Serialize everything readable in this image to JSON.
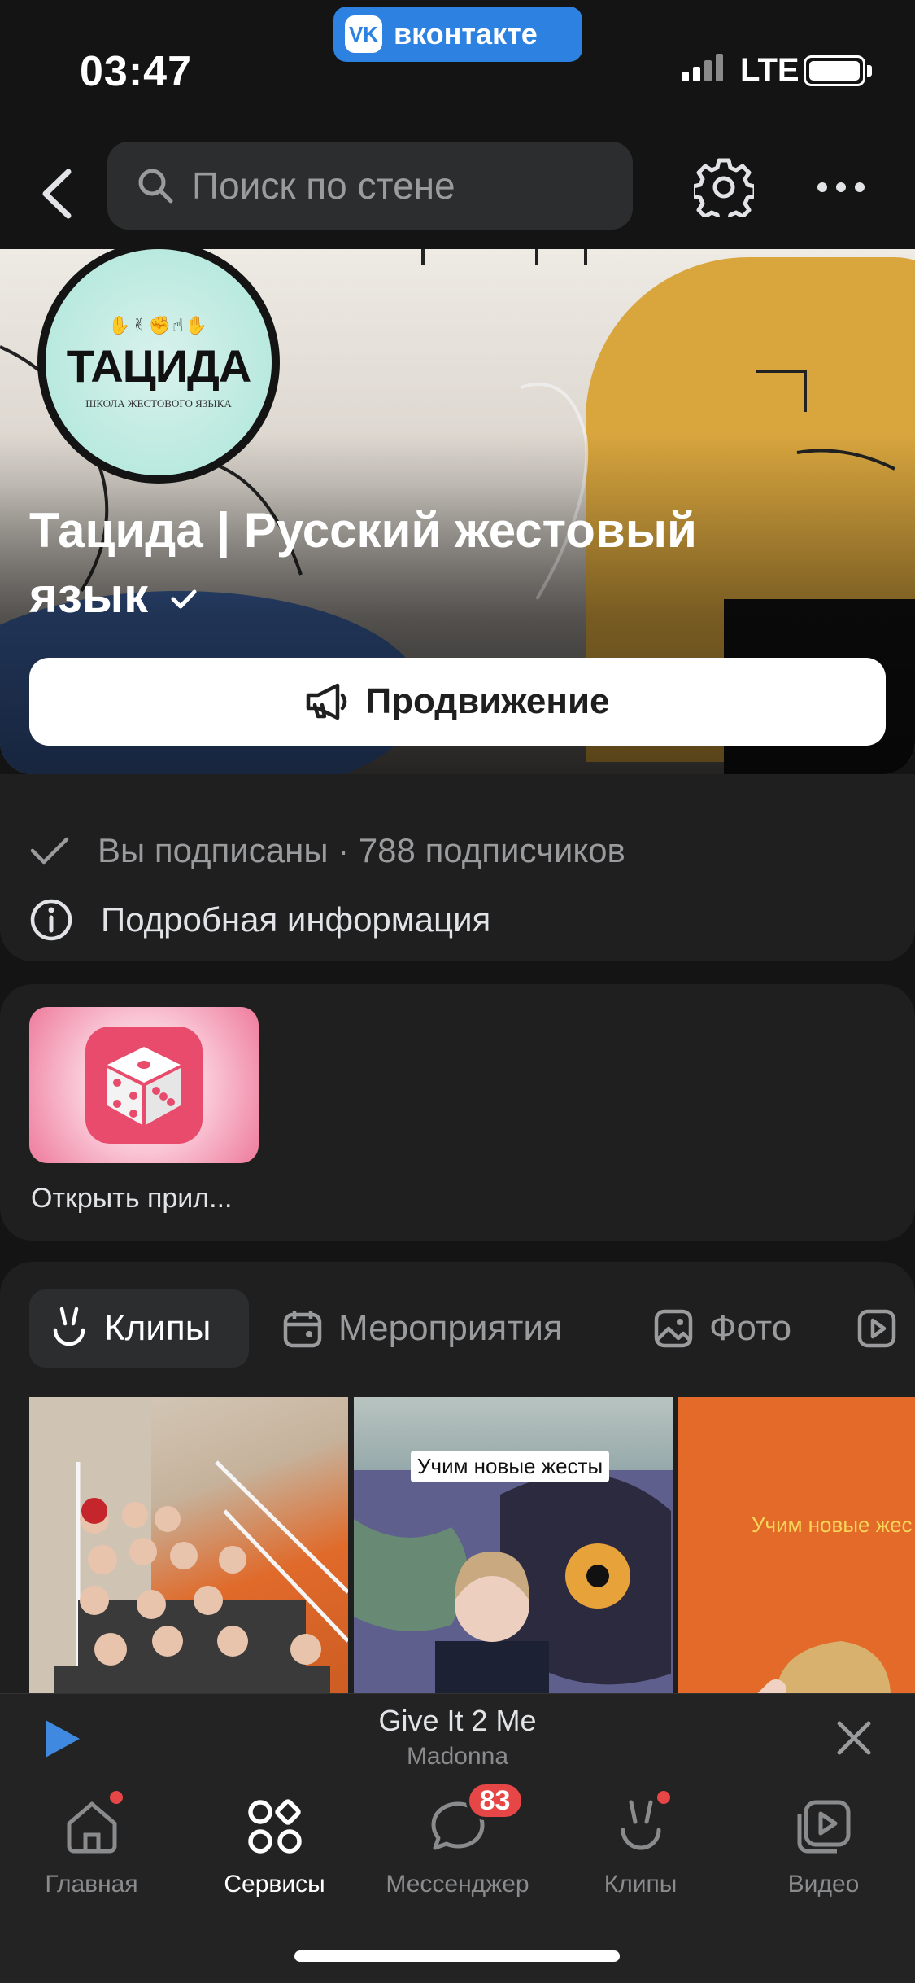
{
  "status_bar": {
    "time": "03:47",
    "app_badge": "вконтакте",
    "network": "LTE"
  },
  "header": {
    "search_placeholder": "Поиск по стене",
    "icons": [
      "back-arrow",
      "search",
      "gear",
      "more-dots"
    ]
  },
  "group": {
    "avatar_title": "ТАЦИДА",
    "avatar_subtitle": "ШКОЛА ЖЕСТОВОГО ЯЗЫКА",
    "name": "Тацида | Русский жестовый язык",
    "verified": true,
    "promo_button": "Продвижение"
  },
  "info": {
    "subscription": "Вы подписаны · 788 подписчиков",
    "details": "Подробная информация"
  },
  "apps": {
    "items": [
      {
        "label": "Открыть прил...",
        "icon": "dice-icon",
        "color": "#e84b6b"
      }
    ]
  },
  "media": {
    "tabs": [
      {
        "label": "Клипы",
        "icon": "clips-icon",
        "active": true
      },
      {
        "label": "Мероприятия",
        "icon": "calendar-icon",
        "active": false
      },
      {
        "label": "Фото",
        "icon": "photo-icon",
        "active": false
      }
    ],
    "clips": [
      {
        "caption": ""
      },
      {
        "caption": "Учим новые жесты"
      },
      {
        "caption": "Учим новые жес"
      }
    ]
  },
  "player": {
    "title": "Give It 2 Me",
    "artist": "Madonna",
    "accent": "#3f8ae0"
  },
  "tabbar": {
    "items": [
      {
        "label": "Главная",
        "icon": "home-icon",
        "active": false,
        "dot": true
      },
      {
        "label": "Сервисы",
        "icon": "services-icon",
        "active": true
      },
      {
        "label": "Мессенджер",
        "icon": "messenger-icon",
        "active": false,
        "badge": "83"
      },
      {
        "label": "Клипы",
        "icon": "clips-icon",
        "active": false,
        "dot": true
      },
      {
        "label": "Видео",
        "icon": "video-icon",
        "active": false
      }
    ]
  },
  "colors": {
    "background": "#141414",
    "card": "#1f1f20",
    "vk_blue": "#2d81e0",
    "badge_red": "#e64646"
  }
}
